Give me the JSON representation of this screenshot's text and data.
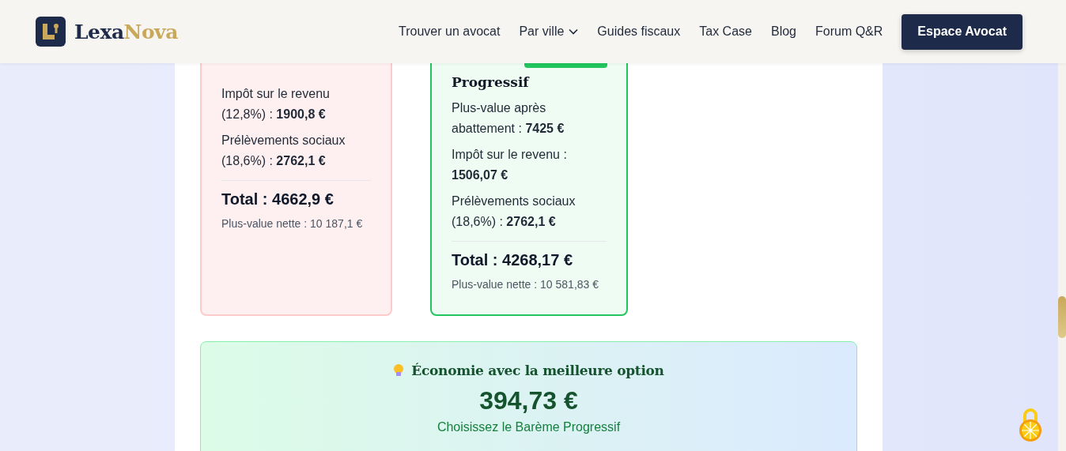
{
  "header": {
    "brand": {
      "first": "Lexa",
      "second": "Nova"
    },
    "nav": [
      {
        "label": "Trouver un avocat",
        "dropdown": false
      },
      {
        "label": "Par ville",
        "dropdown": true
      },
      {
        "label": "Guides fiscaux",
        "dropdown": false
      },
      {
        "label": "Tax Case",
        "dropdown": false
      },
      {
        "label": "Blog",
        "dropdown": false
      },
      {
        "label": "Forum Q&R",
        "dropdown": false
      }
    ],
    "cta": "Espace Avocat"
  },
  "cards": [
    {
      "best": false,
      "lines": [
        "Impôt sur le revenu (12,8%) : **1900,8 €**",
        "Prélèvements sociaux (18,6%) : **2762,1 €**"
      ],
      "total": "Total : 4662,9 €",
      "net": "Plus-value nette : 10 187,1 €"
    },
    {
      "best": true,
      "title": "Progressif",
      "lines": [
        "Plus-value après abattement : **7425 €**",
        "Impôt sur le revenu : **1506,07 €**",
        "Prélèvements sociaux (18,6%) : **2762,1 €**"
      ],
      "total": "Total : 4268,17 €",
      "net": "Plus-value nette : 10 581,83 €"
    }
  ],
  "savings": {
    "title": "Économie avec la meilleure option",
    "amount": "394,73 €",
    "advice": "Choisissez le Barème Progressif"
  }
}
